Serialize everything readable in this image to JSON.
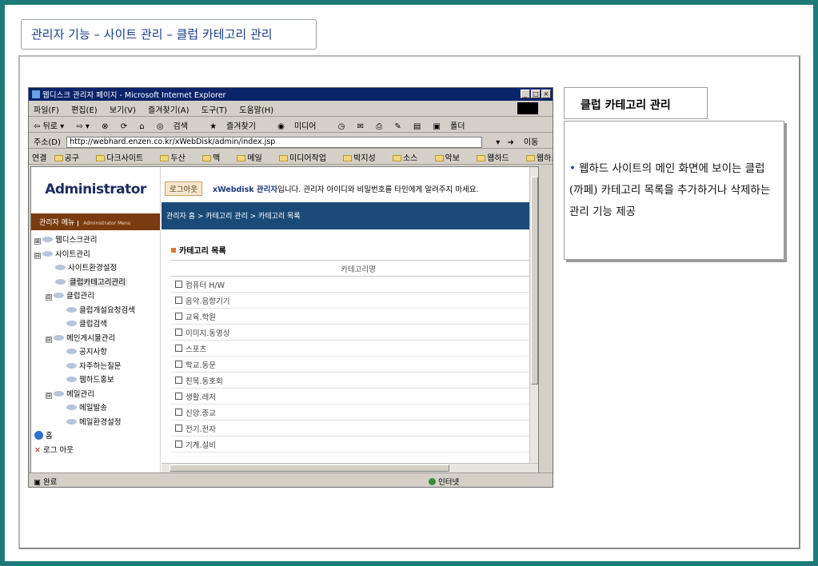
{
  "slide": {
    "title": "관리자 기능 – 사이트 관리 – 클럽 카테고리 관리"
  },
  "browser": {
    "title": "웹디스크 관리자 페이지 - Microsoft Internet Explorer",
    "menu": [
      "파일(F)",
      "편집(E)",
      "보기(V)",
      "즐겨찾기(A)",
      "도구(T)",
      "도움말(H)"
    ],
    "toolbar": {
      "back": "⇦ 뒤로 ▾",
      "forward": "⇨ ▾",
      "search": "검색",
      "favorites": "즐겨찾기",
      "media": "미디어",
      "folder": "폴더"
    },
    "address_label": "주소(D)",
    "address_value": "http://webhard.enzen.co.kr/xWebDisk/admin/index.jsp",
    "go_label": "이동",
    "links_label": "연결",
    "links": [
      "공구",
      "다크사이트",
      "두산",
      "맥",
      "메일",
      "미디어작업",
      "박지성",
      "소스",
      "악보",
      "웹하드",
      "웹하드홍보처"
    ],
    "status": "완료",
    "zone": "인터넷"
  },
  "admin": {
    "logo": "Administrator",
    "menu_label": "관리자 메뉴",
    "menu_sub": "Administrator Menu",
    "logout": "로그아웃",
    "brand": "xWebdisk 관리자",
    "notice": "입니다. 관리자 아이디와 비밀번호를 타인에게 알려주지 마세요.",
    "breadcrumb": "관리자 홈 > 카테고리 관리 > 카테고리 목록",
    "section_title": "카테고리 목록",
    "column_header": "카테고리명",
    "categories": [
      "컴퓨터 H/W",
      "음악.음향기기",
      "교육.학원",
      "이미지.동영상",
      "스포츠",
      "학교.동문",
      "친목.동호회",
      "생활.레저",
      "신앙.종교",
      "전기.전자",
      "기계.설비"
    ]
  },
  "tree": [
    {
      "label": "웹디스크관리",
      "level": 0,
      "expander": "⊞"
    },
    {
      "label": "사이트관리",
      "level": 0,
      "expander": "⊟"
    },
    {
      "label": "사이트환경설정",
      "level": 1,
      "expander": ""
    },
    {
      "label": "클럽카테고리관리",
      "level": 1,
      "expander": "",
      "selected": true
    },
    {
      "label": "클럽관리",
      "level": 1,
      "expander": "⊟"
    },
    {
      "label": "클럽개설요청검색",
      "level": 2,
      "expander": ""
    },
    {
      "label": "클럽검색",
      "level": 2,
      "expander": ""
    },
    {
      "label": "메인게시물관리",
      "level": 1,
      "expander": "⊟"
    },
    {
      "label": "공지사항",
      "level": 2,
      "expander": ""
    },
    {
      "label": "자주하는질문",
      "level": 2,
      "expander": ""
    },
    {
      "label": "웹하드홍보",
      "level": 2,
      "expander": ""
    },
    {
      "label": "메일관리",
      "level": 1,
      "expander": "⊟"
    },
    {
      "label": "메일발송",
      "level": 2,
      "expander": ""
    },
    {
      "label": "메일환경설정",
      "level": 2,
      "expander": ""
    }
  ],
  "tree_footer": {
    "home": "홈",
    "logout": "로그 아웃"
  },
  "description": {
    "title": "클럽 카테고리 관리",
    "bullet": "•",
    "text": "웹하드 사이트의 메인 화면에 보이는 클럽(까페) 카테고리 목록을 추가하거나 삭제하는 관리 기능 제공"
  }
}
